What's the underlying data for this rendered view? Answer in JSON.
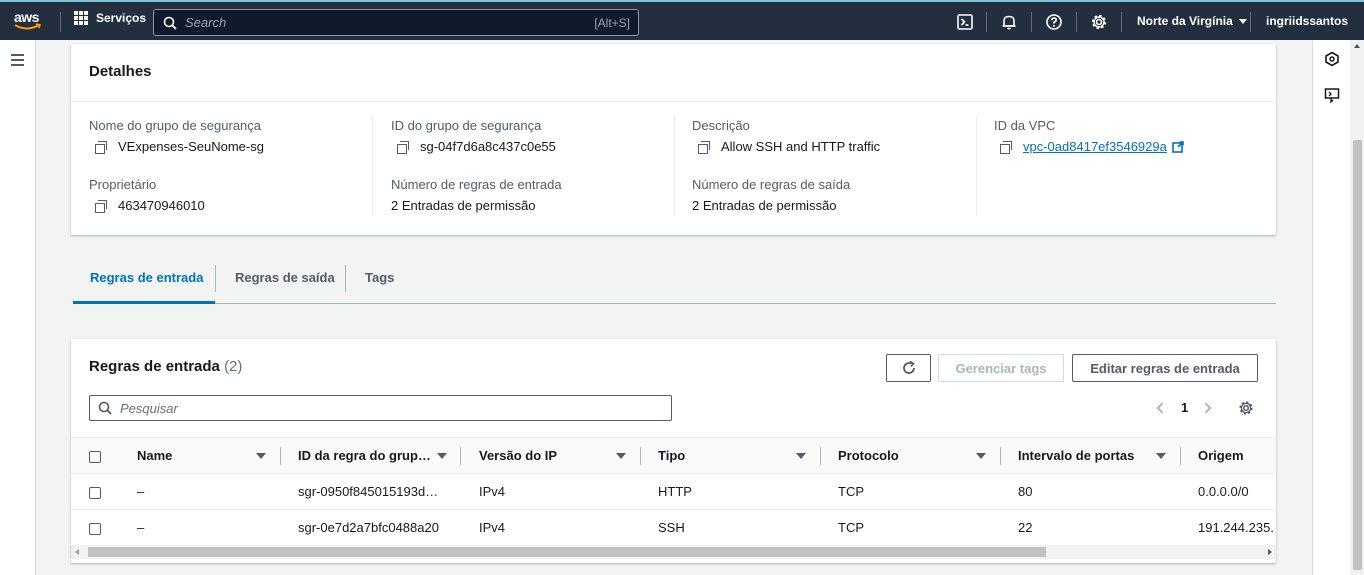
{
  "topnav": {
    "logo": "aws",
    "services": "Serviços",
    "search_placeholder": "Search",
    "search_shortcut": "[Alt+S]",
    "region": "Norte da Virgínia",
    "user": "ingriidssantos",
    "icons": [
      "cloudshell-icon",
      "notifications-icon",
      "help-icon",
      "settings-icon"
    ]
  },
  "details": {
    "title": "Detalhes",
    "fields": [
      {
        "label": "Nome do grupo de segurança",
        "value": "VExpenses-SeuNome-sg",
        "copy": true
      },
      {
        "label": "ID do grupo de segurança",
        "value": "sg-04f7d6a8c437c0e55",
        "copy": true
      },
      {
        "label": "Descrição",
        "value": "Allow SSH and HTTP traffic",
        "copy": true
      },
      {
        "label": "ID da VPC",
        "value": "vpc-0ad8417ef3546929a",
        "copy": true,
        "link": true
      },
      {
        "label": "Proprietário",
        "value": "463470946010",
        "copy": true
      },
      {
        "label": "Número de regras de entrada",
        "value": "2 Entradas de permissão",
        "copy": false
      },
      {
        "label": "Número de regras de saída",
        "value": "2 Entradas de permissão",
        "copy": false
      }
    ]
  },
  "tabs": [
    {
      "label": "Regras de entrada",
      "active": true
    },
    {
      "label": "Regras de saída",
      "active": false
    },
    {
      "label": "Tags",
      "active": false
    }
  ],
  "rules": {
    "title": "Regras de entrada",
    "count": "(2)",
    "refresh_icon": "refresh-icon",
    "manage_tags": "Gerenciar tags",
    "edit_rules": "Editar regras de entrada",
    "search_placeholder": "Pesquisar",
    "page": "1",
    "columns": [
      "Name",
      "ID da regra do grup…",
      "Versão do IP",
      "Tipo",
      "Protocolo",
      "Intervalo de portas",
      "Origem"
    ],
    "rows": [
      [
        "–",
        "sgr-0950f845015193d…",
        "IPv4",
        "HTTP",
        "TCP",
        "80",
        "0.0.0.0/0"
      ],
      [
        "–",
        "sgr-0e7d2a7bfc0488a20",
        "IPv4",
        "SSH",
        "TCP",
        "22",
        "191.244.235."
      ]
    ]
  },
  "colors": {
    "nav_bg": "#232f3e",
    "link": "#0073bb",
    "accent_active_tab": "#0073bb"
  }
}
